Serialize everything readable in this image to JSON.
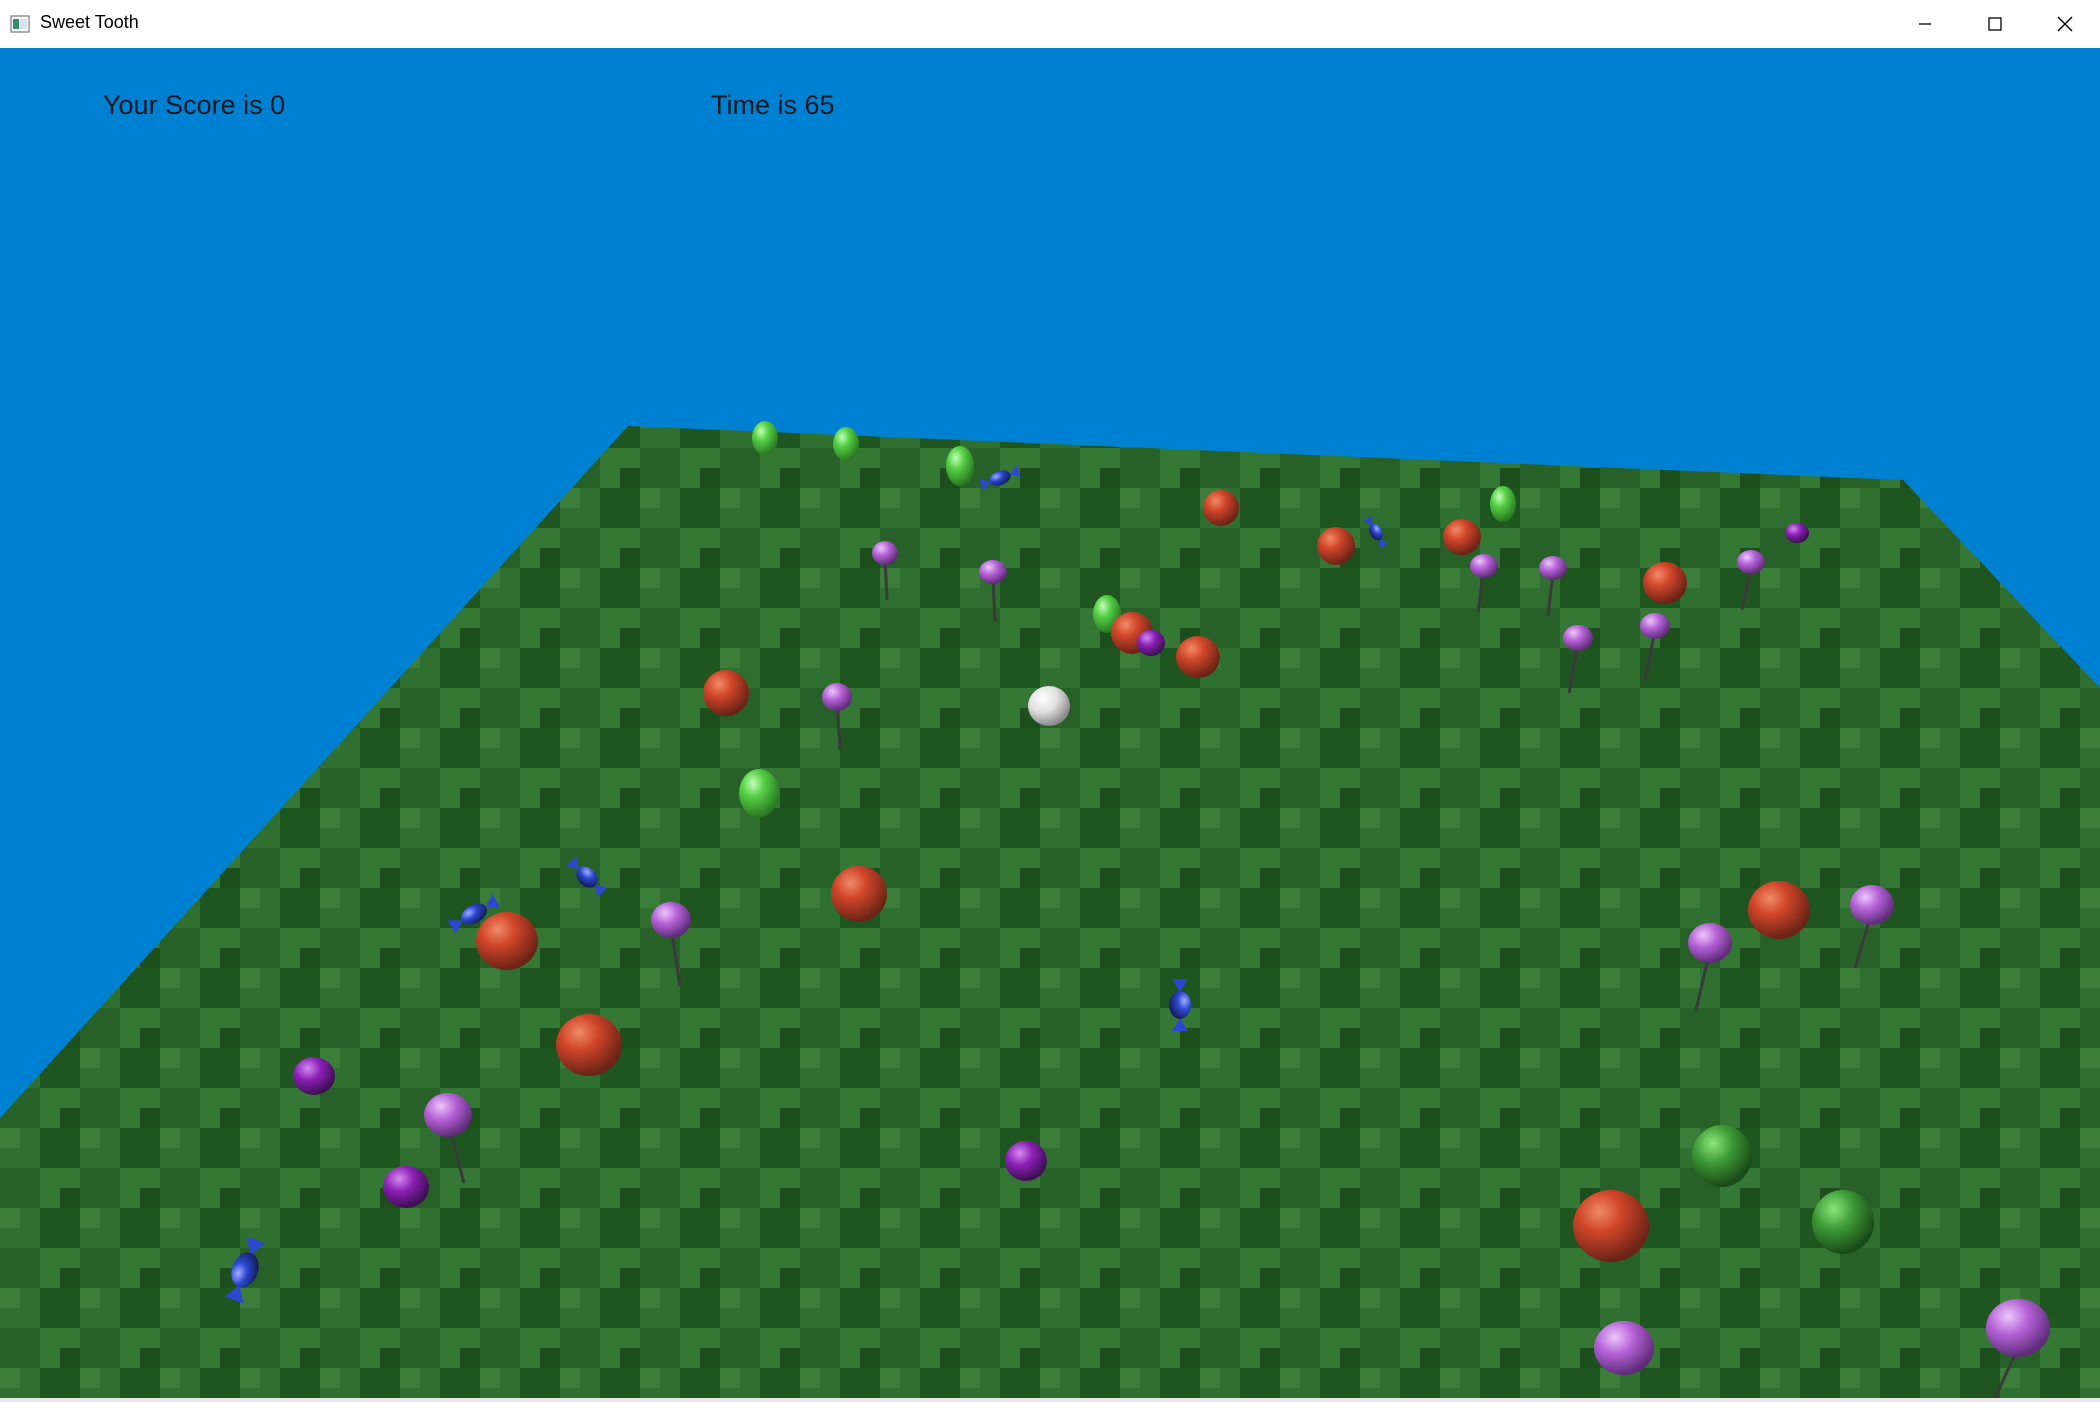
{
  "window": {
    "title": "Sweet Tooth",
    "icon": "app-window-icon",
    "controls": {
      "minimize": "minimize-icon",
      "maximize": "maximize-icon",
      "close": "close-icon"
    }
  },
  "hud": {
    "score_text": "Your Score is 0",
    "time_text": "Time is 65"
  },
  "scene": {
    "sky_color": "#0080d0",
    "ground_color": "#2a6a2a",
    "colors": {
      "apple": "#d0462a",
      "pear": "#55d046",
      "lollipop": "#b461d6",
      "gumball": "#8a1fb4",
      "wrapped_candy": "#2c47d0",
      "player_ball": "#e8e8e8",
      "green_blob": "#3d9a36"
    }
  }
}
